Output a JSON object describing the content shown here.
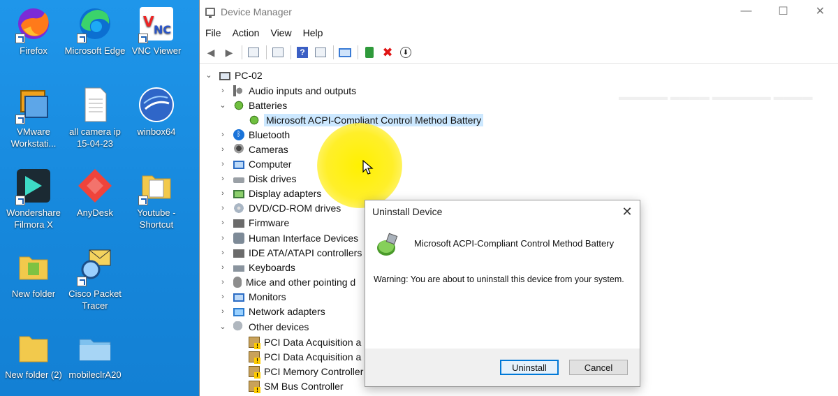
{
  "desktop": {
    "icons": [
      {
        "label": "Firefox"
      },
      {
        "label": "Microsoft Edge"
      },
      {
        "label": "VNC Viewer"
      },
      {
        "label": "VMware Workstati..."
      },
      {
        "label": "all camera ip 15-04-23"
      },
      {
        "label": "winbox64"
      },
      {
        "label": "Wondershare Filmora X"
      },
      {
        "label": "AnyDesk"
      },
      {
        "label": "Youtube - Shortcut"
      },
      {
        "label": "New folder"
      },
      {
        "label": "Cisco Packet Tracer"
      },
      {
        "label": "New folder (2)"
      },
      {
        "label": "mobileclrA20"
      }
    ]
  },
  "window": {
    "title": "Device Manager",
    "controls": {
      "minimize": "—",
      "maximize": "☐",
      "close": "✕"
    }
  },
  "menu": {
    "file": "File",
    "action": "Action",
    "view": "View",
    "help": "Help"
  },
  "tree": {
    "root": "PC-02",
    "items": [
      {
        "label": "Audio inputs and outputs",
        "chevron": "›"
      },
      {
        "label": "Batteries",
        "chevron": "⌄"
      },
      {
        "label": "Microsoft ACPI-Compliant Control Method Battery"
      },
      {
        "label": "Bluetooth",
        "chevron": "›"
      },
      {
        "label": "Cameras",
        "chevron": "›"
      },
      {
        "label": "Computer",
        "chevron": "›"
      },
      {
        "label": "Disk drives",
        "chevron": "›"
      },
      {
        "label": "Display adapters",
        "chevron": "›"
      },
      {
        "label": "DVD/CD-ROM drives",
        "chevron": "›"
      },
      {
        "label": "Firmware",
        "chevron": "›"
      },
      {
        "label": "Human Interface Devices",
        "chevron": "›"
      },
      {
        "label": "IDE ATA/ATAPI controllers",
        "chevron": "›"
      },
      {
        "label": "Keyboards",
        "chevron": "›"
      },
      {
        "label": "Mice and other pointing d",
        "chevron": "›"
      },
      {
        "label": "Monitors",
        "chevron": "›"
      },
      {
        "label": "Network adapters",
        "chevron": "›"
      },
      {
        "label": "Other devices",
        "chevron": "⌄"
      },
      {
        "label": "PCI Data Acquisition a"
      },
      {
        "label": "PCI Data Acquisition a"
      },
      {
        "label": "PCI Memory Controller"
      },
      {
        "label": "SM Bus Controller"
      }
    ]
  },
  "dialog": {
    "title": "Uninstall Device",
    "device_name": "Microsoft ACPI-Compliant Control Method Battery",
    "warning": "Warning: You are about to uninstall this device from your system.",
    "uninstall_label": "Uninstall",
    "cancel_label": "Cancel",
    "close_glyph": "✕"
  }
}
